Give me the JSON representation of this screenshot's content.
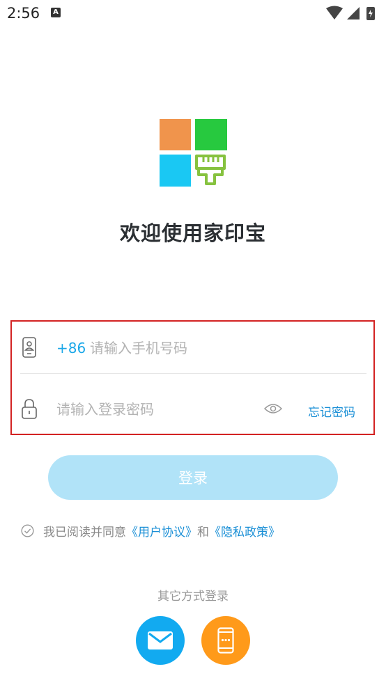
{
  "status_bar": {
    "time": "2:56",
    "notification_icon": "A"
  },
  "app": {
    "welcome": "欢迎使用家印宝"
  },
  "phone_row": {
    "prefix": "+86",
    "placeholder": "请输入手机号码"
  },
  "password_row": {
    "placeholder": "请输入登录密码",
    "forgot": "忘记密码"
  },
  "login_button": "登录",
  "agreement": {
    "prefix": "我已阅读并同意",
    "user_agreement": "《用户协议》",
    "and": "和",
    "privacy_policy": "《隐私政策》"
  },
  "other_login": {
    "title": "其它方式登录",
    "methods": [
      "mail-icon",
      "phone-icon"
    ]
  },
  "colors": {
    "accent": "#1aa7e8",
    "link": "#1a8fd6",
    "login_button_disabled": "#b1e3f8",
    "highlight_border": "#d32222",
    "mail": "#12aaf0",
    "phone": "#ff9a1a"
  }
}
